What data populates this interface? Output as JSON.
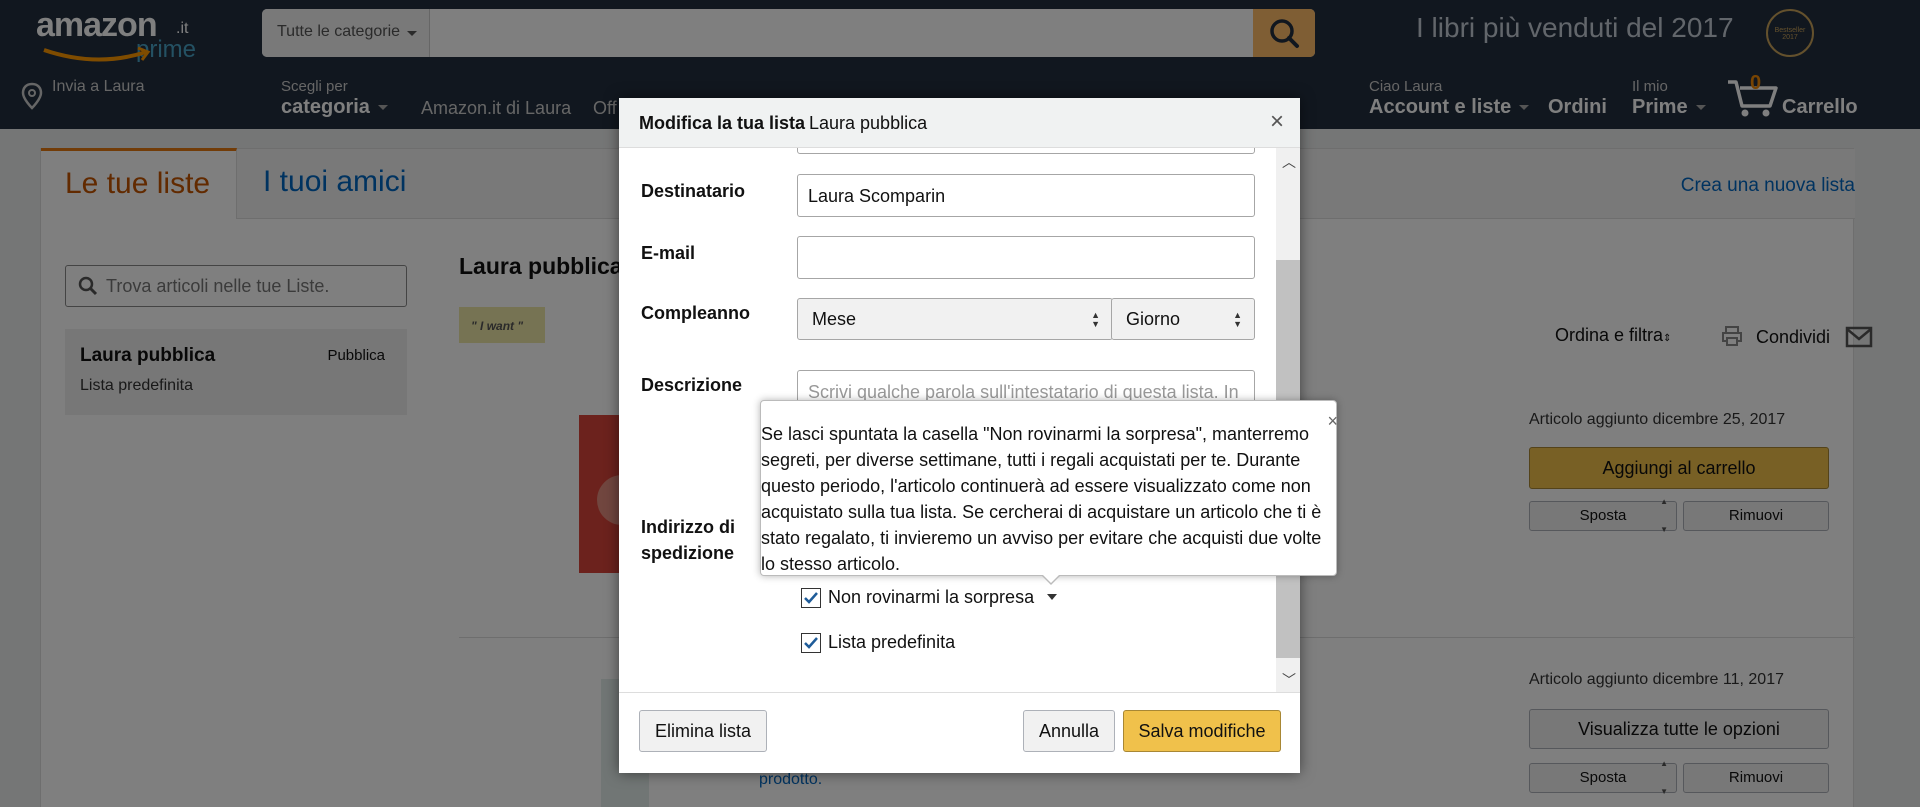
{
  "header": {
    "logo_main": "amazon",
    "logo_tld": ".it",
    "logo_prime": "prime",
    "search_category": "Tutte le categorie",
    "promo": "I libri più venduti del 2017",
    "badge": "Bestseller 2017",
    "deliver_to": "Invia a Laura",
    "shop_by_small": "Scegli per",
    "shop_by_big": "categoria",
    "nav_links": [
      "Amazon.it di Laura",
      "Off"
    ],
    "account_small": "Ciao Laura",
    "account_big": "Account e liste",
    "orders": "Ordini",
    "prime_small": "Il mio",
    "prime_big": "Prime",
    "cart_count": "0",
    "cart_label": "Carrello"
  },
  "page": {
    "tab_active": "Le tue liste",
    "tab_friends": "I tuoi amici",
    "create_link": "Crea una nuova lista",
    "find_placeholder": "Trova articoli nelle tue Liste.",
    "sidebar_list_name": "Laura pubblica",
    "sidebar_list_visibility": "Pubblica",
    "sidebar_list_sub": "Lista predefinita",
    "list_title": "Laura pubblica",
    "tag": "\" I want \"",
    "sort_label": "Ordina e filtra",
    "share_label": "Condividi",
    "product_link": "prodotto.",
    "items": [
      {
        "added_label": "Articolo aggiunto",
        "added_date": "dicembre 25, 2017",
        "primary_btn": "Aggiungi al carrello",
        "move_btn": "Sposta",
        "remove_btn": "Rimuovi"
      },
      {
        "added_label": "Articolo aggiunto",
        "added_date": "dicembre 11, 2017",
        "primary_btn": "Visualizza tutte le opzioni",
        "move_btn": "Sposta",
        "remove_btn": "Rimuovi"
      }
    ]
  },
  "modal": {
    "title_bold": "Modifica la tua lista",
    "title_name": "Laura pubblica",
    "recipient_label": "Destinatario",
    "recipient_value": "Laura Scomparin",
    "email_label": "E-mail",
    "email_value": "",
    "birthday_label": "Compleanno",
    "month_value": "Mese",
    "day_value": "Giorno",
    "description_label": "Descrizione",
    "description_placeholder": "Scrivi qualche parola sull'intestatario di questa lista. In",
    "shipping_label_1": "Indirizzo di",
    "shipping_label_2": "spedizione",
    "no_spoil_label": "Non rovinarmi la sorpresa",
    "no_spoil_checked": true,
    "default_list_label": "Lista predefinita",
    "default_list_checked": true,
    "delete_btn": "Elimina lista",
    "cancel_btn": "Annulla",
    "save_btn": "Salva modifiche",
    "popover_text": "Se lasci spuntata la casella \"Non rovinarmi la sorpresa\", manterremo segreti, per diverse settimane, tutti i regali acquistati per te. Durante questo periodo, l'articolo continuerà ad essere visualizzato come non acquistato sulla tua lista. Se cercherai di acquistare un articolo che ti è stato regalato, ti invieremo un avviso per evitare che acquisti due volte lo stesso articolo."
  },
  "icons": {
    "search": "search-icon",
    "location": "location-pin-icon",
    "cart": "cart-icon",
    "print": "print-icon",
    "mail": "mail-icon",
    "close": "close-icon"
  },
  "colors": {
    "header_bg": "#232f3e",
    "accent_orange": "#e47911",
    "link_blue": "#0066c0",
    "button_yellow": "#f0c14b"
  }
}
